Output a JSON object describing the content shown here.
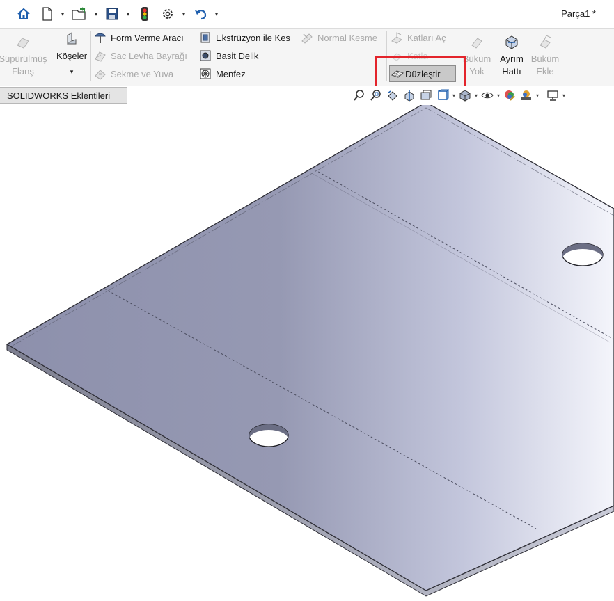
{
  "window": {
    "document_title": "Parça1 *"
  },
  "quick_access": {
    "icons": [
      "home-icon",
      "new-document-icon",
      "open-folder-icon",
      "save-icon",
      "rebuild-traffic-light-icon",
      "options-gear-icon",
      "undo-icon"
    ]
  },
  "ribbon": {
    "swept_flange": {
      "line1": "Süpürülmüş",
      "line2": "Flanş"
    },
    "corners": {
      "label": "Köşeler",
      "dropdown": "▾"
    },
    "form_tool": "Form Verme Aracı",
    "sheet_tab": "Sac Levha Bayrağı",
    "tab_slot": "Sekme ve Yuva",
    "extruded_cut": "Ekstrüzyon ile Kes",
    "simple_hole": "Basit Delik",
    "vent": "Menfez",
    "normal_cut": "Normal Kesme",
    "unfold": "Katları Aç",
    "fold": "Katla",
    "flatten": "Düzleştir",
    "no_bends": {
      "line1": "Büküm",
      "line2": "Yok"
    },
    "split_line": {
      "line1": "Ayrım",
      "line2": "Hattı"
    },
    "insert_bends": {
      "line1": "Büküm",
      "line2": "Ekle"
    }
  },
  "tabs": {
    "addins": "SOLIDWORKS Eklentileri"
  },
  "colors": {
    "highlight": "#e3242b",
    "part_face": "#a6a9c0",
    "part_edge": "#3a3a44"
  }
}
